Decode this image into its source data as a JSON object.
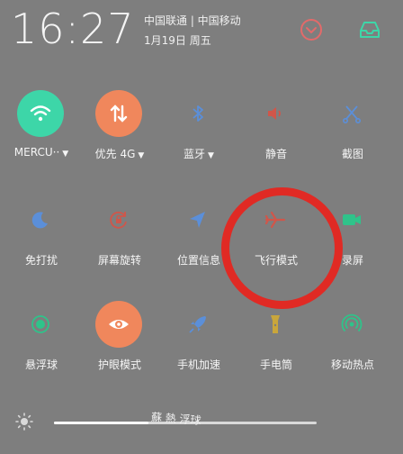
{
  "status": {
    "time": "16:27",
    "carrier": "中国联通 | 中国移动",
    "date": "1月19日  周五"
  },
  "header_icons": [
    "chevron-down-circle-icon",
    "inbox-tray-icon"
  ],
  "colors": {
    "accent_green": "#3dd6a8",
    "accent_orange": "#f0875c",
    "icon_blue": "#5b8fd9",
    "icon_red": "#d0564a",
    "icon_green": "#2fc38a",
    "icon_yellow": "#c9a63b",
    "annotation_red": "#e02a24"
  },
  "tiles": [
    {
      "label": "MERCU··",
      "caret": "▼",
      "icon": "wifi-icon",
      "active": true
    },
    {
      "label": "优先 4G",
      "caret": "▼",
      "icon": "data-transfer-icon",
      "active": true
    },
    {
      "label": "蓝牙",
      "caret": "▼",
      "icon": "bluetooth-icon",
      "active": false
    },
    {
      "label": "静音",
      "caret": "",
      "icon": "speaker-icon",
      "active": false
    },
    {
      "label": "截图",
      "caret": "",
      "icon": "scissors-icon",
      "active": false
    },
    {
      "label": "免打扰",
      "caret": "",
      "icon": "moon-icon",
      "active": false
    },
    {
      "label": "屏幕旋转",
      "caret": "",
      "icon": "rotation-lock-icon",
      "active": false
    },
    {
      "label": "位置信息",
      "caret": "",
      "icon": "location-arrow-icon",
      "active": false
    },
    {
      "label": "飞行模式",
      "caret": "",
      "icon": "airplane-icon",
      "active": false
    },
    {
      "label": "录屏",
      "caret": "",
      "icon": "video-camera-icon",
      "active": false
    },
    {
      "label": "悬浮球",
      "caret": "",
      "icon": "floating-ball-icon",
      "active": false
    },
    {
      "label": "护眼模式",
      "caret": "",
      "icon": "eye-icon",
      "active": true
    },
    {
      "label": "手机加速",
      "caret": "",
      "icon": "rocket-icon",
      "active": false
    },
    {
      "label": "手电筒",
      "caret": "",
      "icon": "flashlight-icon",
      "active": false
    },
    {
      "label": "移动热点",
      "caret": "",
      "icon": "hotspot-icon",
      "active": false
    }
  ],
  "brightness": {
    "icon": "sun-icon",
    "level": 0.36,
    "overlay_text": "蘇 熱 浮球 "
  }
}
